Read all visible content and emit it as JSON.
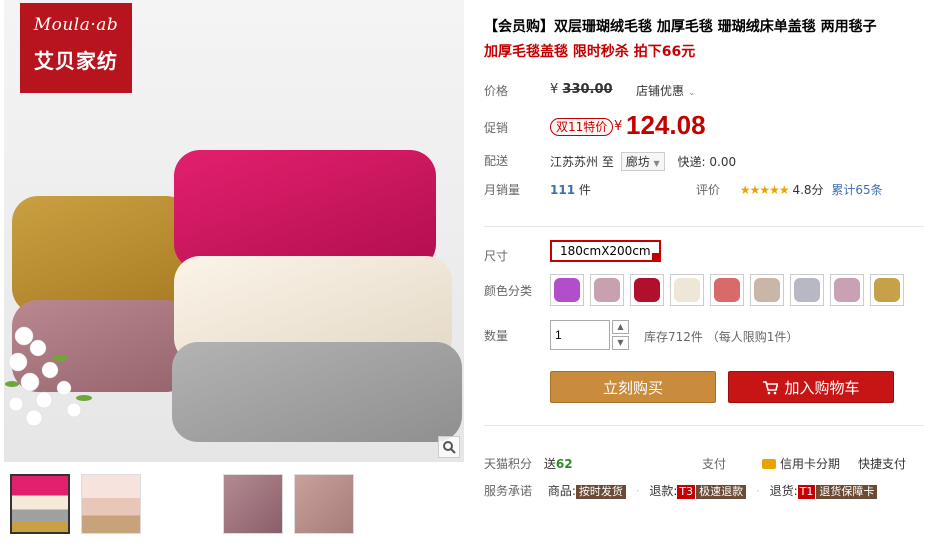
{
  "brand": {
    "logo_latin": "Moula·ab",
    "logo_cn": "艾贝家纺"
  },
  "product": {
    "title": "【会员购】双层珊瑚绒毛毯 加厚毛毯 珊瑚绒床单盖毯 两用毯子",
    "subtitle": "加厚毛毯盖毯 限时秒杀 拍下66元"
  },
  "price": {
    "label": "价格",
    "currency": "¥",
    "original": "330.00",
    "shop_discount": "店铺优惠",
    "promo_label": "促销",
    "promo_tag": "双11特价",
    "promo_price": "124.08"
  },
  "shipping": {
    "label": "配送",
    "origin": "江苏苏州",
    "to": "至",
    "destination": "廊坊",
    "fee": "快递: 0.00"
  },
  "sales": {
    "label": "月销量",
    "count": "111",
    "unit": "件",
    "rating_label": "评价",
    "stars": "★★★★★",
    "score": "4.8分",
    "cumulative": "累计65条"
  },
  "options": {
    "size_label": "尺寸",
    "size_value": "180cmX200cm",
    "color_label": "颜色分类",
    "colors": [
      "#b24ec9",
      "#c9a0b0",
      "#b0102c",
      "#eee6d6",
      "#d86a6a",
      "#c9b6a8",
      "#b8b8c4",
      "#c9a0b4",
      "#c7a04a"
    ],
    "qty_label": "数量",
    "qty_value": "1",
    "stock": "库存712件 （每人限购1件）"
  },
  "actions": {
    "buy_now": "立刻购买",
    "add_cart": "加入购物车"
  },
  "extras": {
    "points_label": "天猫积分",
    "points_text": "送",
    "points_value": "62",
    "pay_label": "支付",
    "credit_card": "信用卡分期",
    "quick_pay": "快捷支付",
    "service_label": "服务承诺",
    "goods_label": "商品:",
    "goods_tag": "按时发货",
    "refund_label": "退款:",
    "refund_t": "T3",
    "refund_tag": "极速退款",
    "return_label": "退货:",
    "return_t": "T1",
    "return_tag": "退货保障卡"
  }
}
